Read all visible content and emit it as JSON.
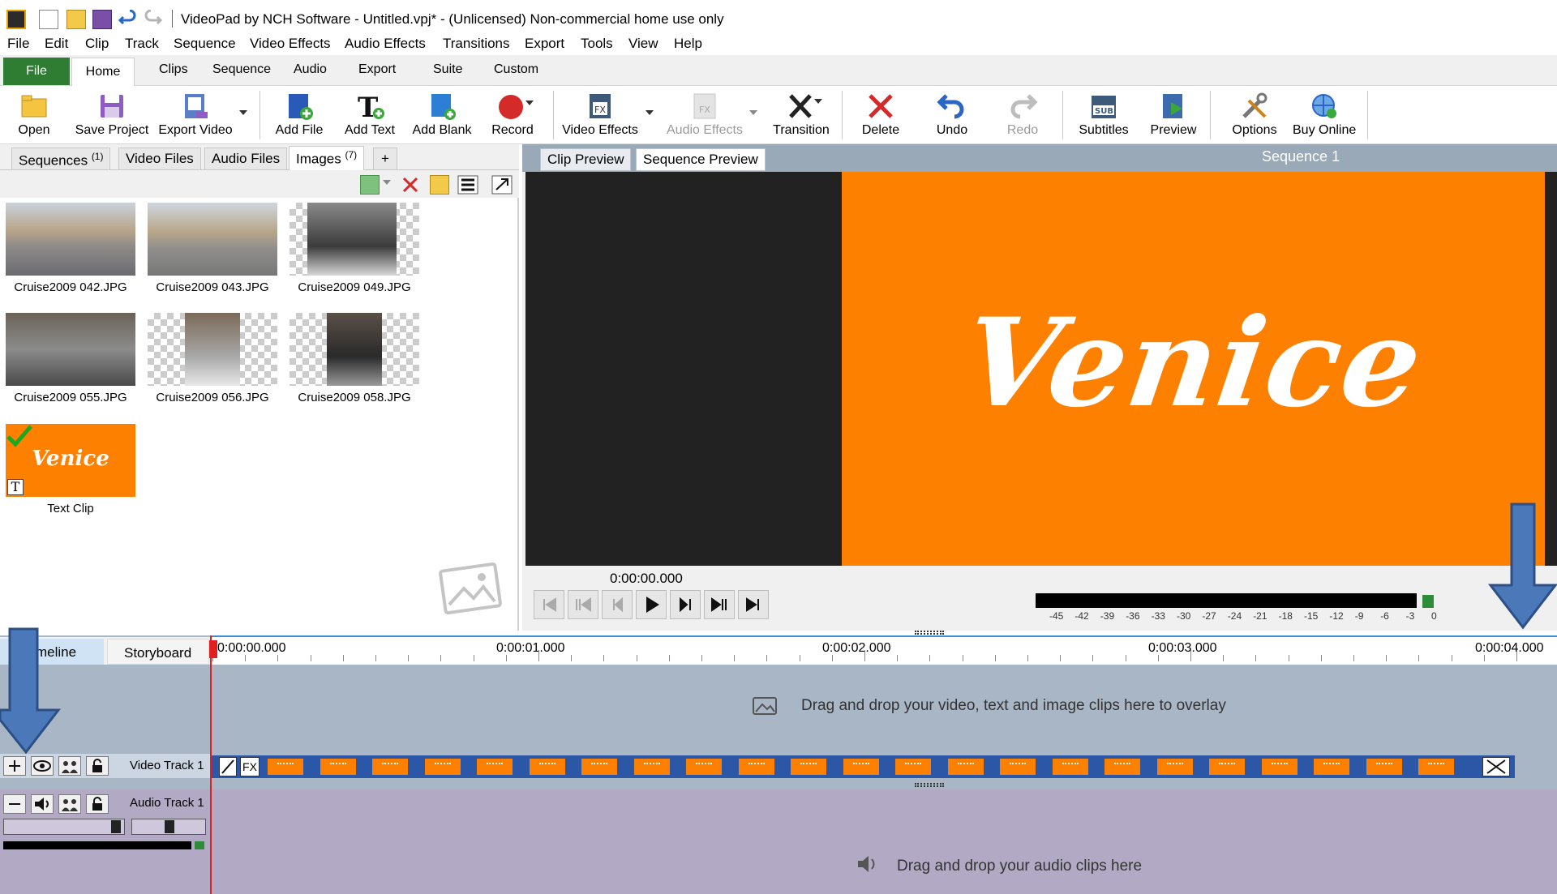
{
  "window": {
    "title": "VideoPad by NCH Software - Untitled.vpj* - (Unlicensed) Non-commercial home use only"
  },
  "menu": [
    "File",
    "Edit",
    "Clip",
    "Track",
    "Sequence",
    "Video Effects",
    "Audio Effects",
    "Transitions",
    "Export",
    "Tools",
    "View",
    "Help"
  ],
  "ribbon_tabs": {
    "file": "File",
    "home": "Home",
    "others": [
      "Clips",
      "Sequence",
      "Audio",
      "Export",
      "Suite",
      "Custom"
    ]
  },
  "toolbar": {
    "open": "Open",
    "save_project": "Save Project",
    "export_video": "Export Video",
    "add_file": "Add File",
    "add_text": "Add Text",
    "add_blank": "Add Blank",
    "record": "Record",
    "video_effects": "Video Effects",
    "audio_effects": "Audio Effects",
    "transition": "Transition",
    "delete": "Delete",
    "undo": "Undo",
    "redo": "Redo",
    "subtitles": "Subtitles",
    "preview": "Preview",
    "options": "Options",
    "buy_online": "Buy Online"
  },
  "bins": {
    "tabs": [
      {
        "label": "Sequences",
        "count": "(1)"
      },
      {
        "label": "Video Files",
        "count": ""
      },
      {
        "label": "Audio Files",
        "count": ""
      },
      {
        "label": "Images",
        "count": "(7)"
      }
    ],
    "add_tab": "+",
    "items": [
      "Cruise2009 042.JPG",
      "Cruise2009 043.JPG",
      "Cruise2009 049.JPG",
      "Cruise2009 055.JPG",
      "Cruise2009 056.JPG",
      "Cruise2009 058.JPG",
      "Text Clip"
    ],
    "text_clip_thumb": "Venice"
  },
  "preview": {
    "tabs": [
      "Clip Preview",
      "Sequence Preview"
    ],
    "sequence_name": "Sequence 1",
    "overlay_text": "Venice",
    "timecode": "0:00:00.000",
    "meter_ticks": [
      "-45",
      "-42",
      "-39",
      "-36",
      "-33",
      "-30",
      "-27",
      "-24",
      "-21",
      "-18",
      "-15",
      "-12",
      "-9",
      "-6",
      "-3",
      "0"
    ]
  },
  "timeline": {
    "tabs": [
      "meline",
      "Storyboard"
    ],
    "ruler": [
      "0:00:00.000",
      "0:00:01.000",
      "0:00:02.000",
      "0:00:03.000",
      "0:00:04.000"
    ],
    "overlay_msg": "Drag and drop your video, text and image clips here to overlay",
    "video_track": "Video Track 1",
    "audio_track": "Audio Track 1",
    "audio_msg": "Drag and drop your audio clips here",
    "fx": "FX"
  },
  "colors": {
    "accent_green": "#2e7d32",
    "clip_orange": "#fe8000",
    "track_blue": "#2c57a6",
    "playhead_red": "#e02020",
    "arrow_blue": "#4a78b8"
  }
}
